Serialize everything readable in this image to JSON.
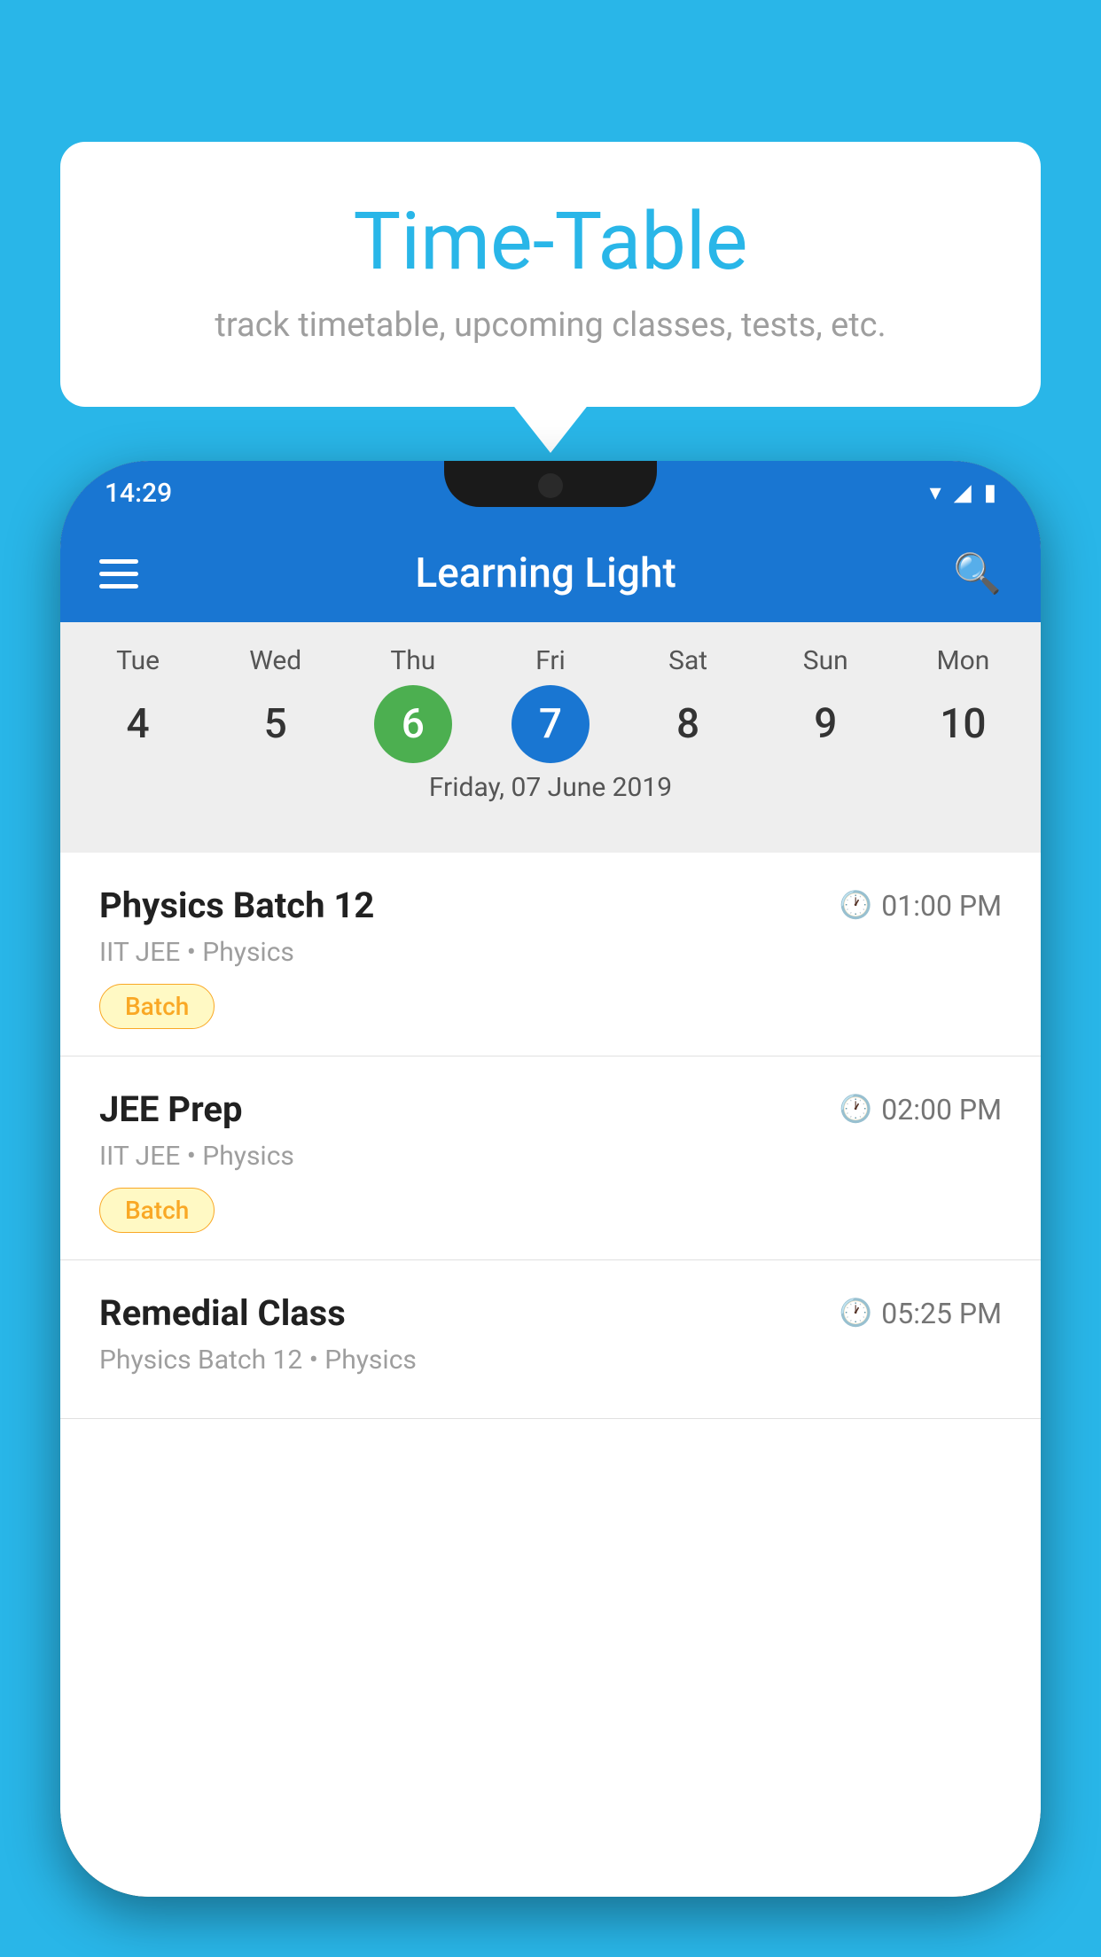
{
  "page": {
    "background_color": "#29B6E8"
  },
  "tooltip": {
    "title": "Time-Table",
    "subtitle": "track timetable, upcoming classes, tests, etc."
  },
  "app": {
    "title": "Learning Light",
    "menu_icon": "hamburger-icon",
    "search_icon": "search-icon"
  },
  "status_bar": {
    "time": "14:29"
  },
  "calendar": {
    "selected_date_label": "Friday, 07 June 2019",
    "days": [
      {
        "label": "Tue",
        "number": "4",
        "state": "normal"
      },
      {
        "label": "Wed",
        "number": "5",
        "state": "normal"
      },
      {
        "label": "Thu",
        "number": "6",
        "state": "today"
      },
      {
        "label": "Fri",
        "number": "7",
        "state": "selected"
      },
      {
        "label": "Sat",
        "number": "8",
        "state": "normal"
      },
      {
        "label": "Sun",
        "number": "9",
        "state": "normal"
      },
      {
        "label": "Mon",
        "number": "10",
        "state": "normal"
      }
    ]
  },
  "schedule": {
    "items": [
      {
        "title": "Physics Batch 12",
        "time": "01:00 PM",
        "subtitle": "IIT JEE • Physics",
        "badge": "Batch"
      },
      {
        "title": "JEE Prep",
        "time": "02:00 PM",
        "subtitle": "IIT JEE • Physics",
        "badge": "Batch"
      },
      {
        "title": "Remedial Class",
        "time": "05:25 PM",
        "subtitle": "Physics Batch 12 • Physics",
        "badge": null
      }
    ]
  }
}
